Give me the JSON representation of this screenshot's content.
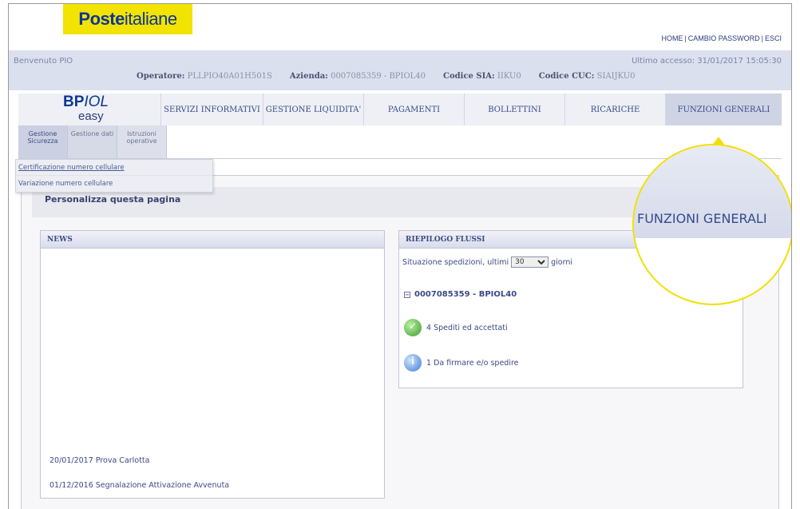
{
  "header": {
    "logo_bold": "Poste",
    "logo_regular": "italiane",
    "links": [
      "HOME",
      "CAMBIO PASSWORD",
      "ESCI"
    ]
  },
  "info": {
    "welcome": "Benvenuto PIO",
    "last_access": "Ultimo accesso: 31/01/2017 15:05:30",
    "operatore_label": "Operatore:",
    "operatore_value": "PLLPIO40A01H501S",
    "azienda_label": "Azienda:",
    "azienda_value": "0007085359 - BPIOL40",
    "sia_label": "Codice SIA:",
    "sia_value": "IIKU0",
    "cuc_label": "Codice CUC:",
    "cuc_value": "SIAIJKU0"
  },
  "product": {
    "bp": "BP",
    "iol": "IOL",
    "easy": "easy"
  },
  "nav": {
    "tabs": [
      "SERVIZI INFORMATIVI",
      "GESTIONE LIQUIDITA'",
      "PAGAMENTI",
      "BOLLETTINI",
      "RICARICHE",
      "FUNZIONI GENERALI"
    ],
    "active": "FUNZIONI GENERALI"
  },
  "subnav": {
    "tabs": [
      [
        "Gestione",
        "Sicurezza"
      ],
      [
        "Gestione dati",
        ""
      ],
      [
        "Istruzioni",
        "operative"
      ]
    ],
    "dropdown": [
      "Certificazione numero cellulare",
      "Variazione numero cellulare"
    ]
  },
  "content": {
    "personalize": "Personalizza questa pagina",
    "news": {
      "title": "NEWS",
      "items": [
        "20/01/2017  Prova Carlotta",
        "01/12/2016  Segnalazione Attivazione Avvenuta"
      ]
    },
    "flussi": {
      "title": "RIEPILOGO FLUSSI",
      "situazione_prefix": "Situazione spedizioni, ultimi",
      "days_selected": "30",
      "situazione_suffix": "giorni",
      "company_toggle": "−",
      "company": "0007085359 - BPIOL40",
      "status_ok": "4 Spediti ed accettati",
      "status_pending": "1 Da firmare e/o spedire"
    }
  },
  "callout": {
    "text": "FUNZIONI GENERALI",
    "color": "#f2df00"
  }
}
